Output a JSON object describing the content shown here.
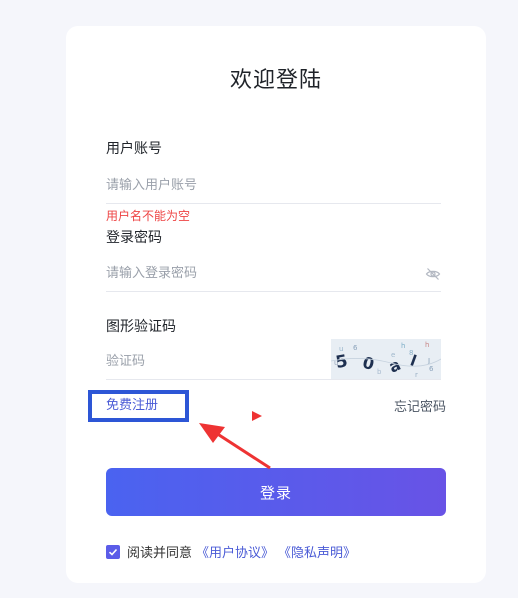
{
  "title": "欢迎登陆",
  "username": {
    "label": "用户账号",
    "placeholder": "请输入用户账号",
    "error": "用户名不能为空"
  },
  "password": {
    "label": "登录密码",
    "placeholder": "请输入登录密码"
  },
  "captcha": {
    "label": "图形验证码",
    "placeholder": "验证码"
  },
  "register_label": "免费注册",
  "forgot_label": "忘记密码",
  "login_label": "登录",
  "agree": {
    "checked": true,
    "text": "阅读并同意",
    "user_agreement": "《用户协议》",
    "privacy": "《隐私声明》"
  },
  "colors": {
    "accent": "#5b5ce8",
    "error": "#ee4444",
    "annotation_box": "#2d56d6",
    "annotation_arrow": "#ee3333"
  }
}
